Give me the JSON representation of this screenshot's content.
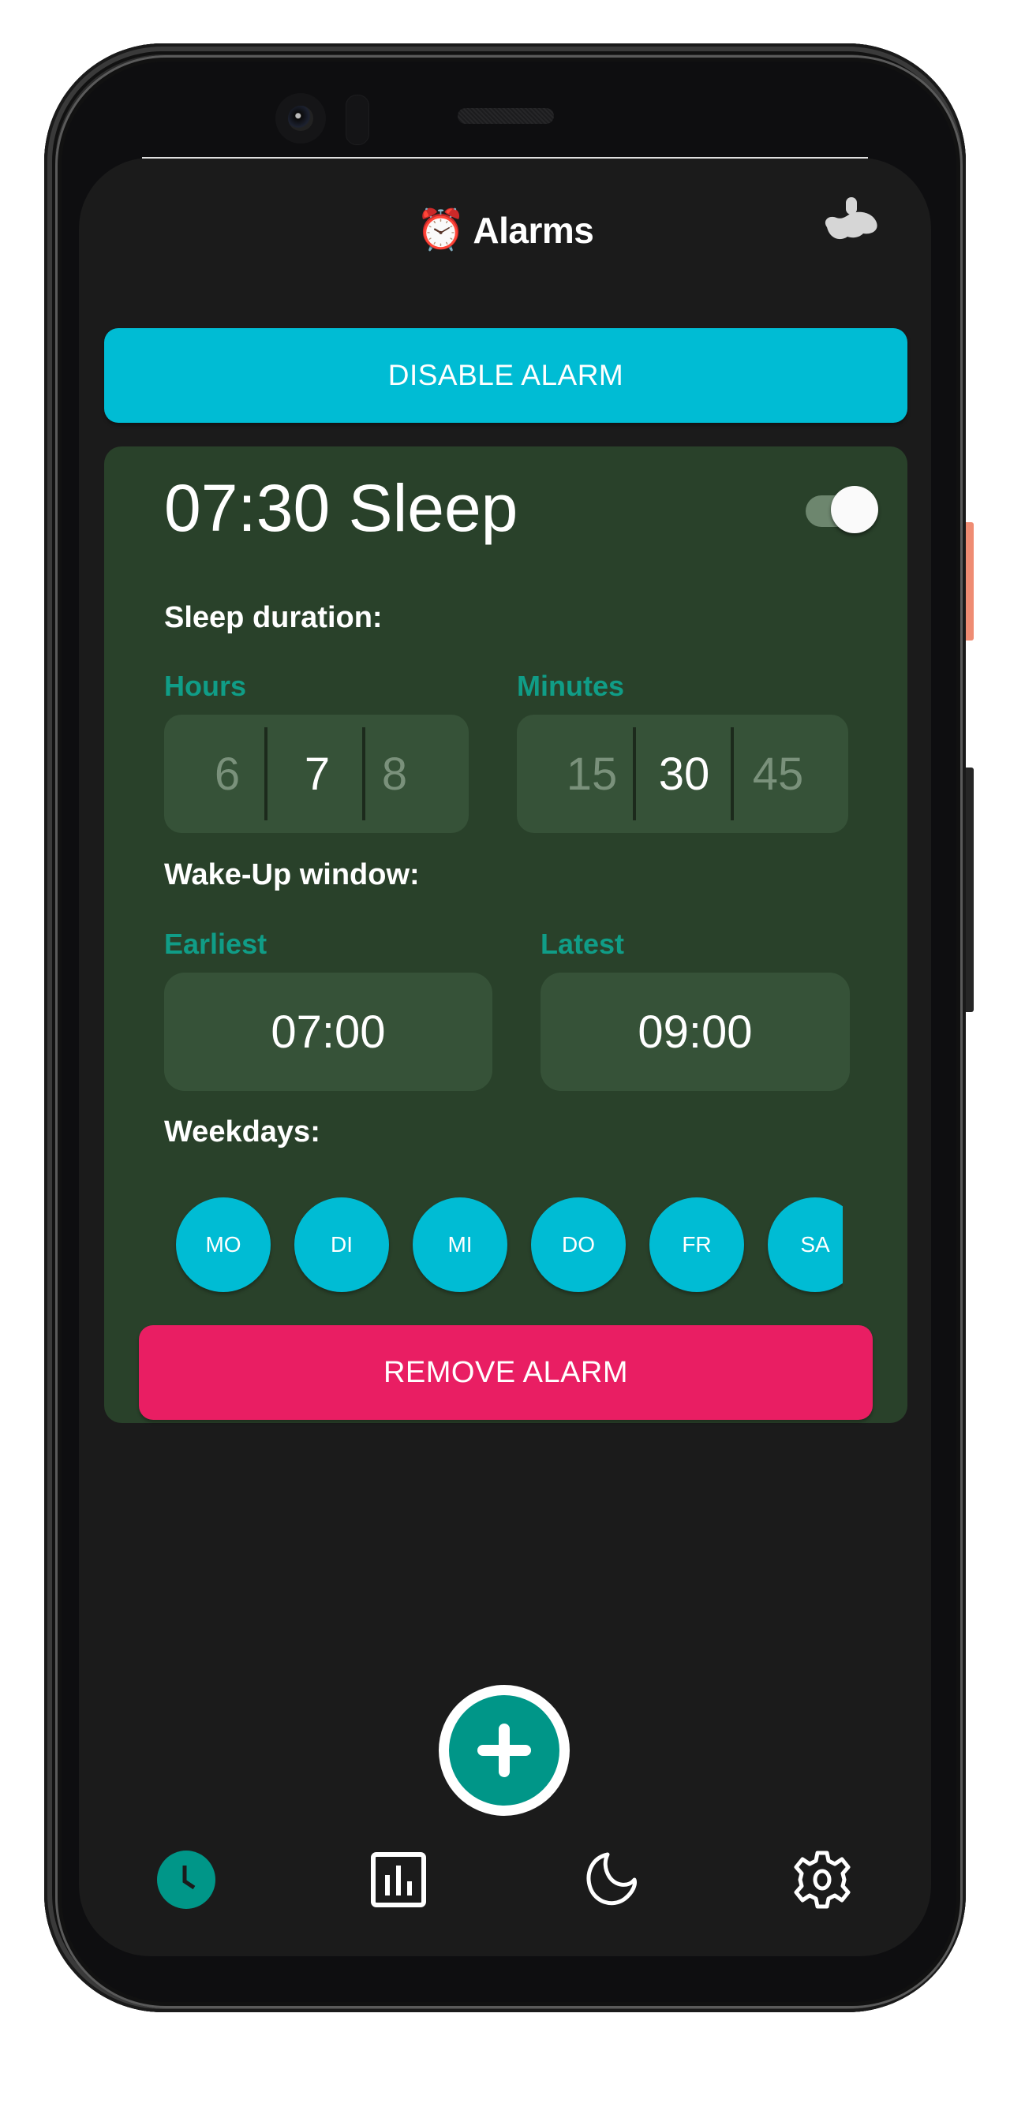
{
  "app": {
    "title": "Alarms",
    "title_emoji": "⏰",
    "weather_icon": "weather-cloud-icon"
  },
  "actions": {
    "disable_alarm_label": "DISABLE ALARM",
    "remove_alarm_label": "REMOVE ALARM",
    "add_alarm_icon": "plus-icon"
  },
  "alarm": {
    "title": "07:30 Sleep",
    "enabled": true,
    "sleep_duration": {
      "label": "Sleep duration:",
      "hours": {
        "label": "Hours",
        "previous": "6",
        "selected": "7",
        "next": "8"
      },
      "minutes": {
        "label": "Minutes",
        "previous": "15",
        "selected": "30",
        "next": "45"
      }
    },
    "wake_up_window": {
      "label": "Wake-Up window:",
      "earliest": {
        "label": "Earliest",
        "value": "07:00"
      },
      "latest": {
        "label": "Latest",
        "value": "09:00"
      }
    },
    "weekdays": {
      "label": "Weekdays:",
      "days": [
        {
          "label": "MO",
          "active": true
        },
        {
          "label": "DI",
          "active": true
        },
        {
          "label": "MI",
          "active": true
        },
        {
          "label": "DO",
          "active": true
        },
        {
          "label": "FR",
          "active": true
        },
        {
          "label": "SA",
          "active": true
        }
      ]
    }
  },
  "bottom_nav": {
    "items": [
      {
        "name": "alarms",
        "icon": "clock-icon",
        "active": true
      },
      {
        "name": "statistics",
        "icon": "bar-chart-icon",
        "active": false
      },
      {
        "name": "sleep",
        "icon": "moon-icon",
        "active": false
      },
      {
        "name": "settings",
        "icon": "gear-icon",
        "active": false
      }
    ]
  },
  "colors": {
    "background": "#1b1b1b",
    "card": "#29412a",
    "primary_cyan": "#00bcd4",
    "danger_pink": "#e91e63",
    "accent_teal": "#009688",
    "label_teal": "#109d87"
  }
}
